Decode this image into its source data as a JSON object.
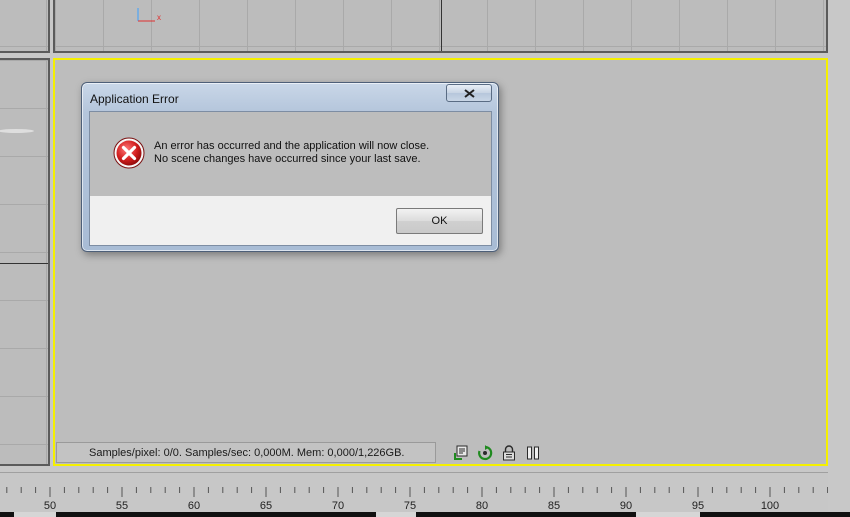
{
  "dialog": {
    "title": "Application Error",
    "close_glyph": "✕",
    "message_line1": "An error has occurred and the application will now close.",
    "message_line2": "No scene changes have occurred since your last save.",
    "ok_label": "OK",
    "icon": "error-x-icon"
  },
  "status_bar": {
    "text": "Samples/pixel: 0/0. Samples/sec: 0,000M. Mem: 0,000/1,226GB.",
    "icons": [
      "save-render-icon",
      "refresh-icon",
      "lock-icon",
      "pause-icon"
    ]
  },
  "viewport": {
    "axis_label": "x",
    "active_border_color": "#f5f000"
  },
  "timeline": {
    "labels": [
      "50",
      "55",
      "60",
      "65",
      "70",
      "75",
      "80",
      "85",
      "90",
      "95",
      "100"
    ]
  }
}
